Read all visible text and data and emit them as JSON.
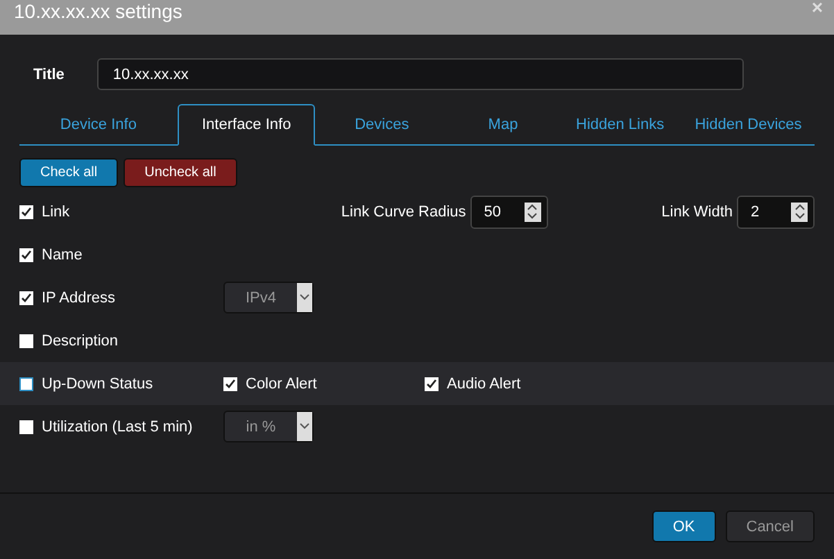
{
  "window": {
    "title": "10.xx.xx.xx settings",
    "close": "×"
  },
  "title_field": {
    "label": "Title",
    "value": "10.xx.xx.xx"
  },
  "tabs": [
    {
      "label": "Device Info",
      "selected": false
    },
    {
      "label": "Interface Info",
      "selected": true
    },
    {
      "label": "Devices",
      "selected": false
    },
    {
      "label": "Map",
      "selected": false
    },
    {
      "label": "Hidden Links",
      "selected": false
    },
    {
      "label": "Hidden Devices",
      "selected": false
    }
  ],
  "actions": [
    {
      "label": "Check all",
      "kind": "primary"
    },
    {
      "label": "Uncheck all",
      "kind": "danger"
    }
  ],
  "rows": [
    {
      "kind": "spinners",
      "label": "Link",
      "checked": true,
      "selected": false,
      "spinners": [
        {
          "label": "Link Curve Radius",
          "value": "50"
        },
        {
          "label": "Link Width",
          "value": "2"
        }
      ]
    },
    {
      "kind": "plain",
      "label": "Name",
      "checked": true,
      "selected": false
    },
    {
      "kind": "select",
      "label": "IP Address",
      "checked": true,
      "selected": false,
      "select": "IPv4"
    },
    {
      "kind": "plain",
      "label": "Description",
      "checked": false,
      "selected": false
    },
    {
      "kind": "alerts",
      "label": "Up-Down Status",
      "checked": false,
      "selected": true,
      "alerts": [
        {
          "label": "Color Alert",
          "checked": true
        },
        {
          "label": "Audio Alert",
          "checked": true
        }
      ]
    },
    {
      "kind": "select",
      "label": "Utilization (Last 5 min)",
      "checked": false,
      "selected": false,
      "select": "in %"
    }
  ],
  "footer": [
    {
      "label": "OK",
      "kind": "primary"
    },
    {
      "label": "Cancel",
      "kind": "secondary"
    }
  ]
}
